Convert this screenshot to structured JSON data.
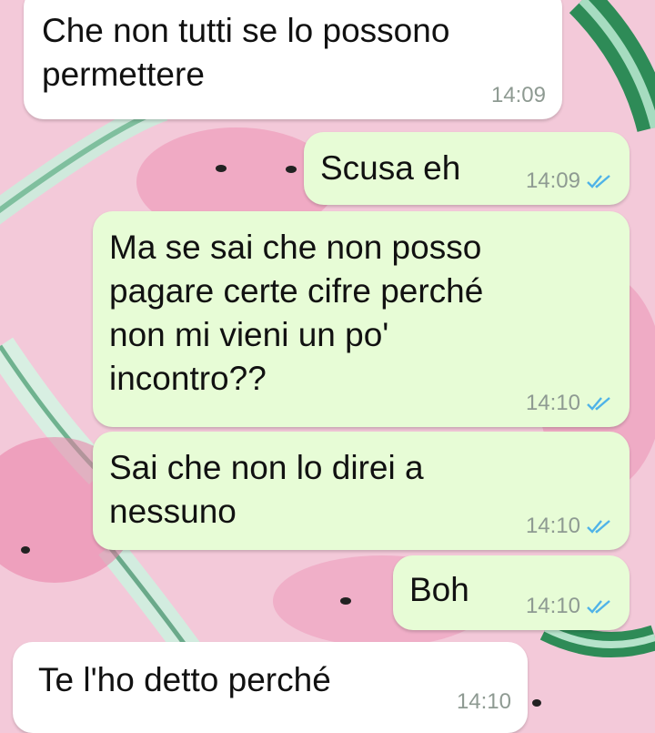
{
  "chat": {
    "messages": [
      {
        "direction": "incoming",
        "text": "Che non tutti se lo possono\npermettere",
        "time": "14:09"
      },
      {
        "direction": "outgoing",
        "text": "Scusa eh",
        "time": "14:09",
        "status": "read-double-check-icon"
      },
      {
        "direction": "outgoing",
        "text": "Ma se sai che non posso\npagare certe cifre perché\nnon mi vieni un po'\nincontro??",
        "time": "14:10",
        "status": "read-double-check-icon"
      },
      {
        "direction": "outgoing",
        "text": "Sai che non lo direi a\nnessuno",
        "time": "14:10",
        "status": "read-double-check-icon"
      },
      {
        "direction": "outgoing",
        "text": "Boh",
        "time": "14:10",
        "status": "read-double-check-icon"
      },
      {
        "direction": "incoming",
        "text": "Te l'ho detto perché",
        "time": "14:10"
      }
    ]
  },
  "colors": {
    "incoming_bubble": "#ffffff",
    "outgoing_bubble": "#e7fcd6",
    "read_ticks": "#4fb3e8",
    "wallpaper_pink": "#f3c9d9",
    "wallpaper_green": "#2e8b57"
  }
}
